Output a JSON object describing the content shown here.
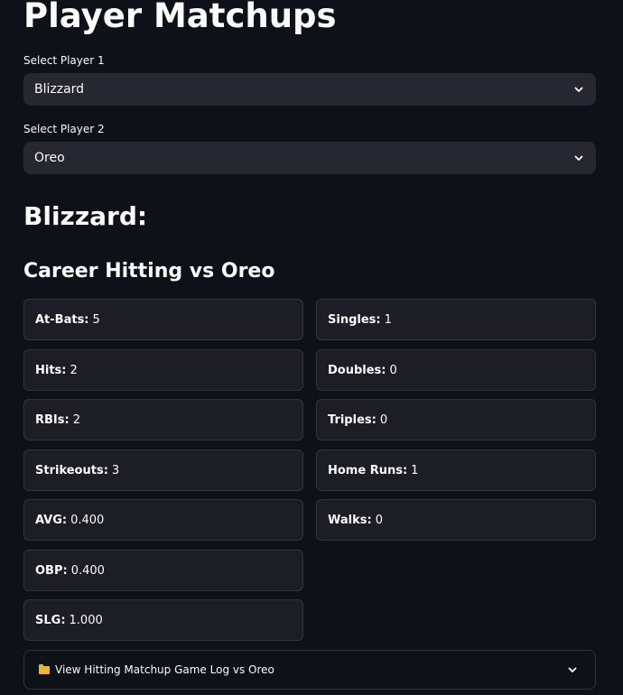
{
  "page": {
    "title": "Player Matchups"
  },
  "selects": {
    "player1": {
      "label": "Select Player 1",
      "value": "Blizzard"
    },
    "player2": {
      "label": "Select Player 2",
      "value": "Oreo"
    }
  },
  "player_heading": "Blizzard:",
  "section_heading": "Career Hitting vs Oreo",
  "stats": {
    "at_bats": {
      "label": "At-Bats:",
      "value": "5"
    },
    "hits": {
      "label": "Hits:",
      "value": "2"
    },
    "rbis": {
      "label": "RBIs:",
      "value": "2"
    },
    "strikeouts": {
      "label": "Strikeouts:",
      "value": "3"
    },
    "avg": {
      "label": "AVG:",
      "value": "0.400"
    },
    "obp": {
      "label": "OBP:",
      "value": "0.400"
    },
    "slg": {
      "label": "SLG:",
      "value": "1.000"
    },
    "singles": {
      "label": "Singles:",
      "value": "1"
    },
    "doubles": {
      "label": "Doubles:",
      "value": "0"
    },
    "triples": {
      "label": "Triples:",
      "value": "0"
    },
    "home_runs": {
      "label": "Home Runs:",
      "value": "1"
    },
    "walks": {
      "label": "Walks:",
      "value": "0"
    }
  },
  "expander": {
    "label": "View Hitting Matchup Game Log vs Oreo",
    "icon": "folder-icon"
  }
}
